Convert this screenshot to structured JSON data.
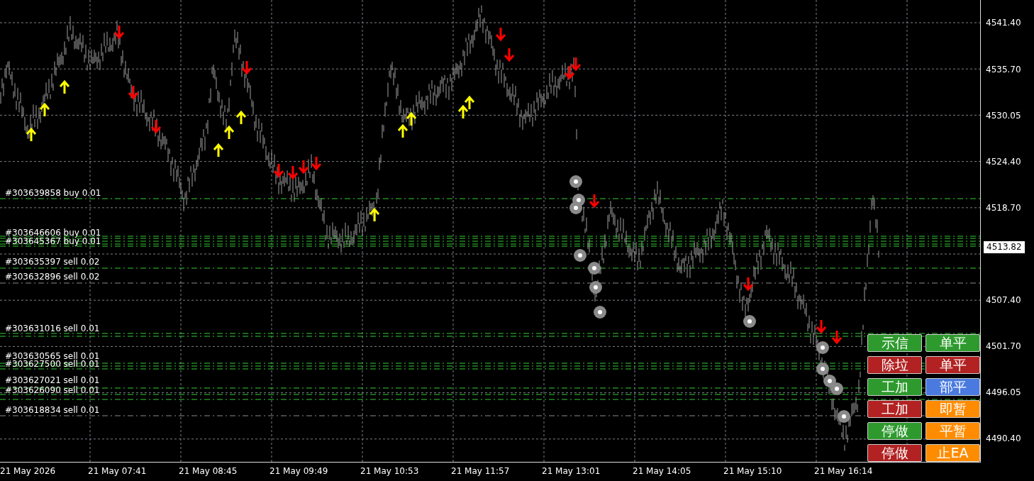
{
  "chart": {
    "order_labels": [
      {
        "text": "#303639858 buy 0.01"
      },
      {
        "text": "#303646606 buy 0.01"
      },
      {
        "text": "#303645367 buy 0.01"
      },
      {
        "text": "#303635397 sell 0.02"
      },
      {
        "text": "#303632896 sell 0.02"
      },
      {
        "text": "#303631016 sell 0.01"
      },
      {
        "text": "#303630565 sell 0.01"
      },
      {
        "text": "#303627500 sell 0.01"
      },
      {
        "text": "#303627021 sell 0.01"
      },
      {
        "text": "#303626090 sell 0.01"
      },
      {
        "text": "#303618834 sell 0.01"
      }
    ]
  },
  "buttons": [
    {
      "label": "示信",
      "color": "#2e9a2e"
    },
    {
      "label": "单平",
      "color": "#2e9a2e"
    },
    {
      "label": "除垃",
      "color": "#b22222"
    },
    {
      "label": "单平",
      "color": "#b22222"
    },
    {
      "label": "工加",
      "color": "#2e9a2e"
    },
    {
      "label": "部平",
      "color": "#4a7ae0"
    },
    {
      "label": "工加",
      "color": "#b22222"
    },
    {
      "label": "即暂",
      "color": "#ff8c00"
    },
    {
      "label": "停做",
      "color": "#2e9a2e"
    },
    {
      "label": "平暂",
      "color": "#ff8c00"
    },
    {
      "label": "停做",
      "color": "#b22222"
    },
    {
      "label": "止EA",
      "color": "#ff8c00"
    }
  ],
  "price_axis": {
    "labels": [
      "4541.40",
      "4535.70",
      "4530.05",
      "4524.40",
      "4518.70",
      "4507.40",
      "4501.70",
      "4496.05",
      "4490.40"
    ],
    "current_price": "4513.82"
  },
  "time_axis": {
    "labels": [
      "21 May 2026",
      "21 May 07:41",
      "21 May 08:45",
      "21 May 09:49",
      "21 May 10:53",
      "21 May 11:57",
      "21 May 13:01",
      "21 May 14:05",
      "21 May 15:10",
      "21 May 16:14"
    ]
  }
}
